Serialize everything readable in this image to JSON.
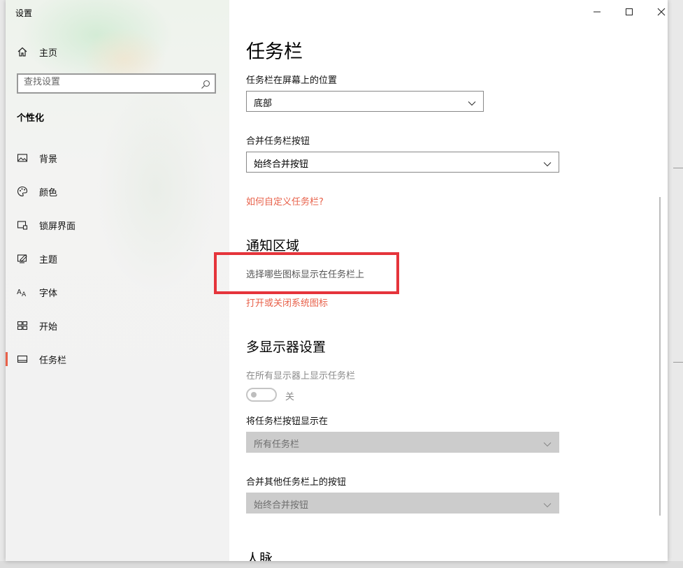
{
  "window": {
    "title": "设置",
    "controls": {
      "minimize": "minimize-icon",
      "maximize": "maximize-icon",
      "close": "close-icon"
    }
  },
  "sidebar": {
    "home_label": "主页",
    "search_placeholder": "查找设置",
    "section": "个性化",
    "items": [
      {
        "label": "背景",
        "icon": "image-icon"
      },
      {
        "label": "颜色",
        "icon": "palette-icon"
      },
      {
        "label": "锁屏界面",
        "icon": "lock-screen-icon"
      },
      {
        "label": "主题",
        "icon": "theme-icon"
      },
      {
        "label": "字体",
        "icon": "font-icon"
      },
      {
        "label": "开始",
        "icon": "start-icon"
      },
      {
        "label": "任务栏",
        "icon": "taskbar-icon",
        "active": true
      }
    ]
  },
  "main": {
    "title": "任务栏",
    "position_label": "任务栏在屏幕上的位置",
    "position_value": "底部",
    "combine_label": "合并任务栏按钮",
    "combine_value": "始终合并按钮",
    "customize_link": "如何自定义任务栏?",
    "notification": {
      "heading": "通知区域",
      "select_icons_link": "选择哪些图标显示在任务栏上",
      "system_icons_link": "打开或关闭系统图标"
    },
    "multi_display": {
      "heading": "多显示器设置",
      "show_all_label": "在所有显示器上显示任务栏",
      "toggle_state": "关",
      "show_buttons_label": "将任务栏按钮显示在",
      "show_buttons_value": "所有任务栏",
      "combine_other_label": "合并其他任务栏上的按钮",
      "combine_other_value": "始终合并按钮"
    },
    "people_heading": "人脉"
  },
  "colors": {
    "accent": "#e8614a",
    "highlight": "#e5343b"
  }
}
